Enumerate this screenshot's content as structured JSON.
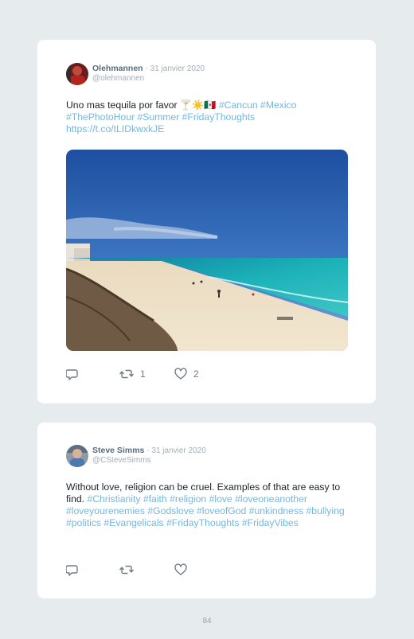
{
  "tweets": [
    {
      "author": "Olehmannen",
      "date": "· 31 janvier 2020",
      "handle": "@olehmannen",
      "text_plain": "Uno mas tequila por favor 🍸☀️🇲🇽",
      "tags": [
        "#Cancun",
        "#Mexico",
        "#ThePhotoHour",
        "#Summer",
        "#FridayThoughts"
      ],
      "link": "https://t.co/tLIDkwxkJE",
      "replies": "",
      "retweets": "1",
      "likes": "2",
      "photo_alt": "Beach in Cancun with turquoise sea"
    },
    {
      "author": "Steve Simms",
      "date": "· 31 janvier 2020",
      "handle": "@CSteveSimms",
      "text_plain": "Without love, religion can be cruel. Examples of that are easy to find.",
      "tags": [
        "#Christianity",
        "#faith",
        "#religion",
        "#love",
        "#loveoneanother",
        "#loveyourenemies",
        "#Godslove",
        "#loveofGod",
        "#unkindness",
        "#bullying",
        "#politics",
        "#Evangelicals",
        "#FridayThoughts",
        "#FridayVibes"
      ],
      "replies": "",
      "retweets": "",
      "likes": ""
    }
  ],
  "page_number": "84",
  "colors": {
    "background": "#e6ebee",
    "card": "#ffffff",
    "hashtag": "#74b8dd",
    "name": "#5a6b7a",
    "meta": "#a3adb6"
  },
  "icons": [
    "reply-icon",
    "retweet-icon",
    "like-icon"
  ]
}
